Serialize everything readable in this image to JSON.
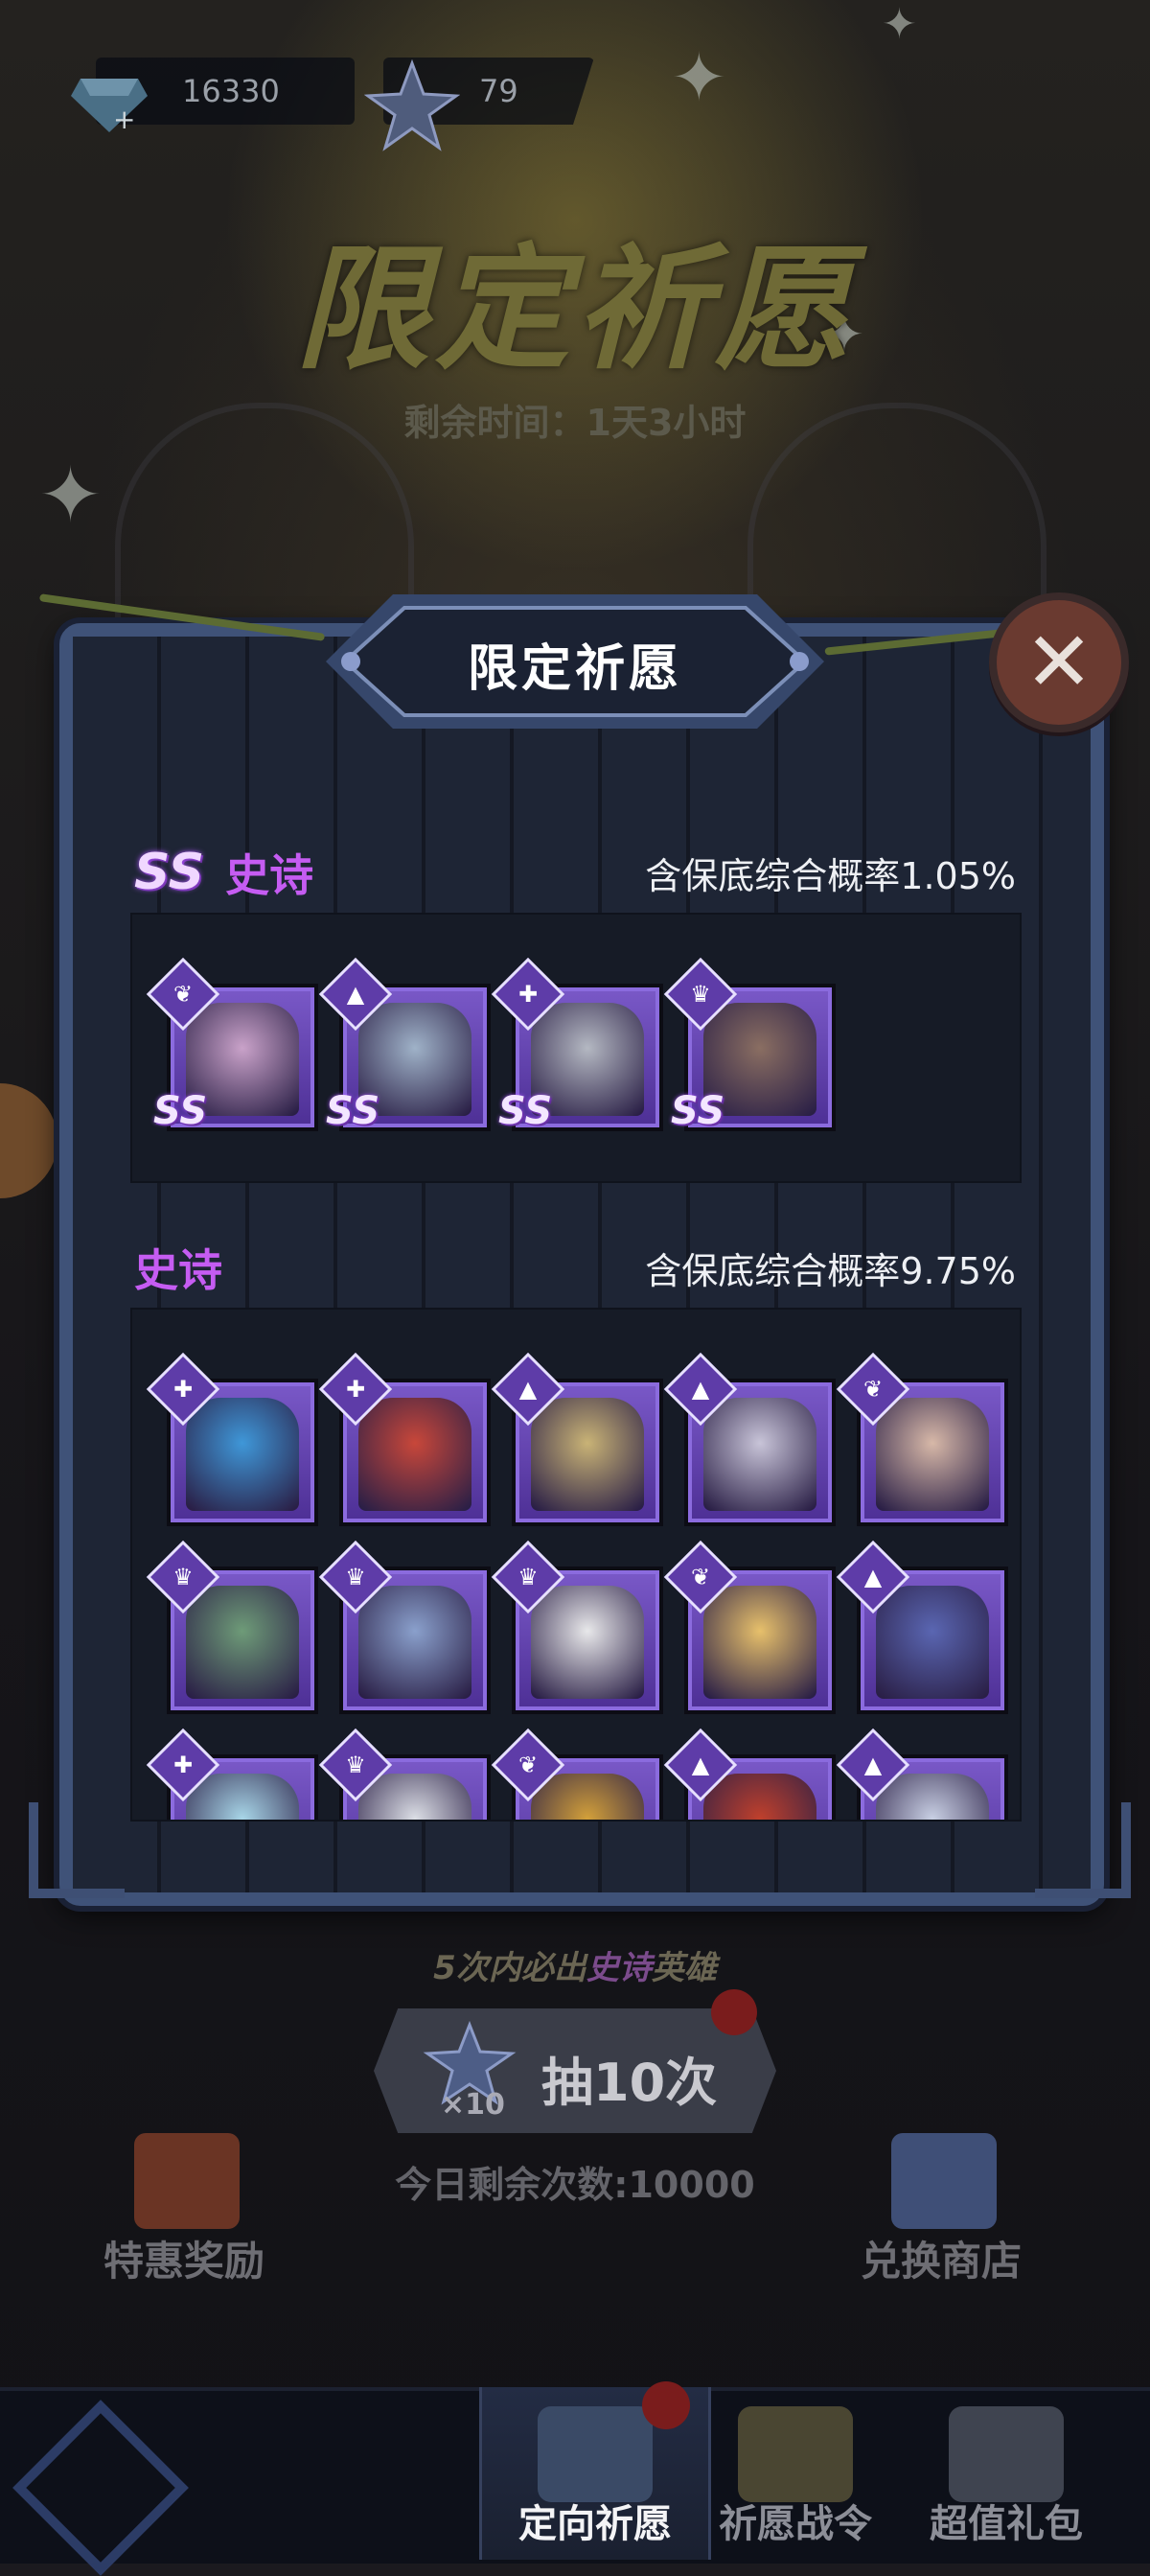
{
  "topbar": {
    "gems": "16330",
    "tickets": "79"
  },
  "banner": {
    "title": "限定祈愿",
    "remaining_time": "剩余时间：1天3小时"
  },
  "modal": {
    "title": "限定祈愿",
    "sections": [
      {
        "badge": "SS",
        "tier": "史诗",
        "probability": "含保底综合概率1.05%",
        "heroes": [
          {
            "class_icon": "feather-icon",
            "ss": "SS",
            "art": "#c9a2c9"
          },
          {
            "class_icon": "flask-icon",
            "ss": "SS",
            "art": "#9fb2c8"
          },
          {
            "class_icon": "wrench-icon",
            "ss": "SS",
            "art": "#b4b8c2"
          },
          {
            "class_icon": "claw-icon",
            "ss": "SS",
            "art": "#8a6e62"
          }
        ]
      },
      {
        "badge": "",
        "tier": "史诗",
        "probability": "含保底综合概率9.75%",
        "heroes": [
          {
            "class_icon": "wrench-icon",
            "art": "#3f97d8"
          },
          {
            "class_icon": "wrench-icon",
            "art": "#c8473a"
          },
          {
            "class_icon": "flask-icon",
            "art": "#c9b376"
          },
          {
            "class_icon": "flask-icon",
            "art": "#c8c4d8"
          },
          {
            "class_icon": "feather-icon",
            "art": "#d7b8a8"
          },
          {
            "class_icon": "claw-icon",
            "art": "#6e9b78"
          },
          {
            "class_icon": "claw-icon",
            "art": "#8aa0cc"
          },
          {
            "class_icon": "claw-icon",
            "art": "#e8e8ea"
          },
          {
            "class_icon": "feather-icon",
            "art": "#e7c06b"
          },
          {
            "class_icon": "flask-icon",
            "art": "#5a66b2"
          },
          {
            "class_icon": "wrench-icon",
            "art": "#a8d6e8"
          },
          {
            "class_icon": "claw-icon",
            "art": "#dcdfe6"
          },
          {
            "class_icon": "feather-icon",
            "art": "#d3a03a"
          },
          {
            "class_icon": "flask-icon",
            "art": "#c0402c"
          },
          {
            "class_icon": "flask-icon",
            "art": "#c9d0e4"
          }
        ]
      }
    ]
  },
  "draw": {
    "pity_prefix": "5次内必出",
    "pity_highlight": "史诗",
    "pity_suffix": "英雄",
    "button_label": "抽10次",
    "multiplier": "×10",
    "today_remaining": "今日剩余次数:10000"
  },
  "side_buttons": {
    "left_label": "特惠奖励",
    "right_label": "兑换商店"
  },
  "nav": {
    "tabs": [
      {
        "label": "定向祈愿",
        "active": true
      },
      {
        "label": "祈愿战令",
        "active": false
      },
      {
        "label": "超值礼包",
        "active": false
      }
    ]
  },
  "colors": {
    "epic_purple": "#c55cf2",
    "frame_blue": "#3f5278",
    "close_red": "#6a3a30"
  }
}
